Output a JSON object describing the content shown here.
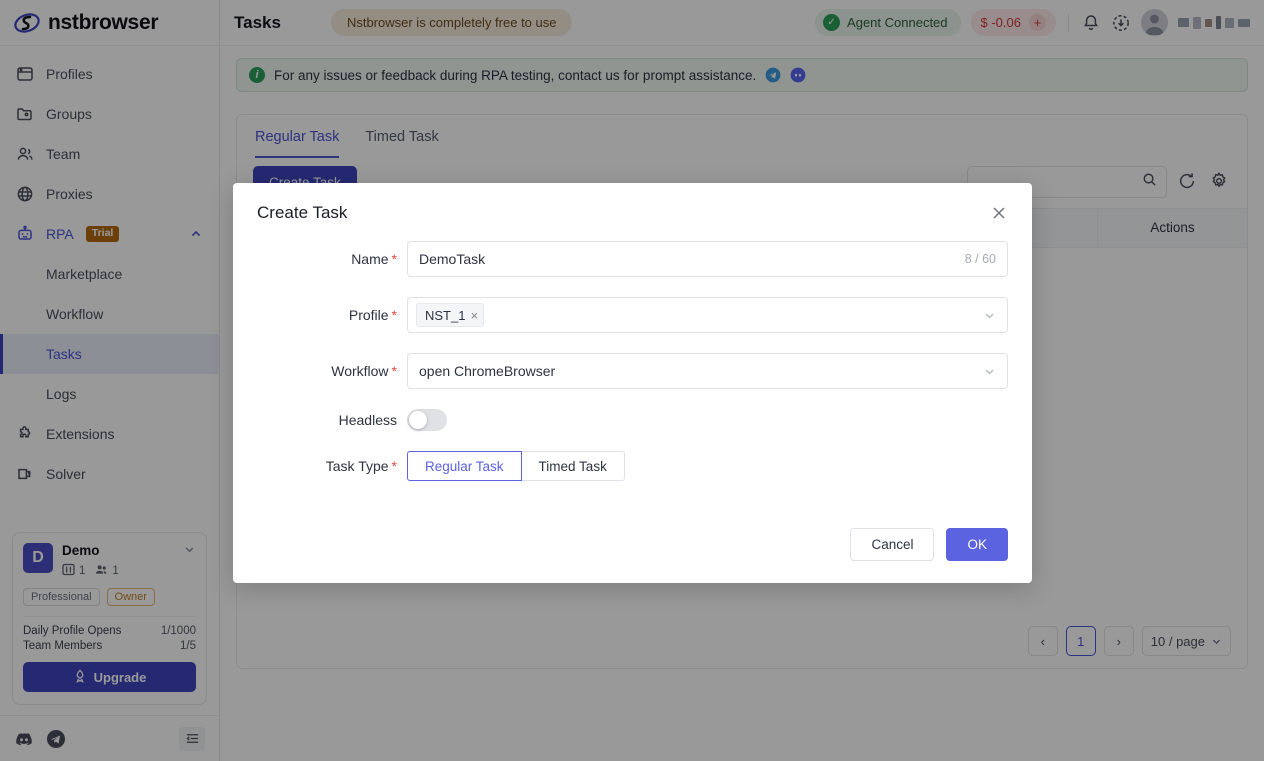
{
  "brand": {
    "name": "nstbrowser"
  },
  "sidebar": {
    "items": [
      {
        "label": "Profiles",
        "icon": "window-icon"
      },
      {
        "label": "Groups",
        "icon": "folder-icon"
      },
      {
        "label": "Team",
        "icon": "people-icon"
      },
      {
        "label": "Proxies",
        "icon": "globe-icon"
      },
      {
        "label": "RPA",
        "icon": "robot-icon",
        "badge": "Trial",
        "expanded": true
      },
      {
        "label": "Marketplace",
        "sub": true
      },
      {
        "label": "Workflow",
        "sub": true
      },
      {
        "label": "Tasks",
        "sub": true,
        "active": true
      },
      {
        "label": "Logs",
        "sub": true
      },
      {
        "label": "Extensions",
        "icon": "puzzle-icon"
      },
      {
        "label": "Solver",
        "icon": "solver-icon"
      }
    ],
    "account": {
      "avatar_letter": "D",
      "name": "Demo",
      "profiles_count": "1",
      "members_count": "1",
      "plan_tag": "Professional",
      "role_tag": "Owner",
      "quotas": [
        {
          "label": "Daily Profile Opens",
          "value": "1/1000"
        },
        {
          "label": "Team Members",
          "value": "1/5"
        }
      ],
      "upgrade_label": "Upgrade"
    },
    "footer": {
      "discord": "discord-icon",
      "telegram": "telegram-icon",
      "collapse": "collapse-sidebar-icon"
    }
  },
  "header": {
    "title": "Tasks",
    "promo": "Nstbrowser is completely free to use",
    "agent_status": "Agent Connected",
    "balance": "$ -0.06",
    "balance_add": "+",
    "notification_icon": "bell-icon",
    "download_icon": "download-icon"
  },
  "notice": {
    "text": "For any issues or feedback during RPA testing, contact us for prompt assistance.",
    "telegram_icon": "telegram-icon",
    "discord_icon": "discord-icon"
  },
  "panel": {
    "tabs": [
      {
        "label": "Regular Task",
        "active": true
      },
      {
        "label": "Timed Task",
        "active": false
      }
    ],
    "create_label": "Create Task",
    "search_placeholder": "",
    "search_value": "",
    "columns": [
      "Actions"
    ],
    "pagination": {
      "prev": "‹",
      "current_page": "1",
      "next": "›",
      "page_size": "10 / page"
    }
  },
  "modal": {
    "title": "Create Task",
    "close_icon": "close-icon",
    "fields": {
      "name": {
        "label": "Name",
        "required": true,
        "value": "DemoTask",
        "placeholder": "",
        "counter": "8 / 60"
      },
      "profile": {
        "label": "Profile",
        "required": true,
        "chips": [
          "NST_1"
        ],
        "chip_remove": "×"
      },
      "workflow": {
        "label": "Workflow",
        "required": true,
        "value": "open ChromeBrowser"
      },
      "headless": {
        "label": "Headless",
        "required": false,
        "on": false
      },
      "task_type": {
        "label": "Task Type",
        "required": true,
        "options": [
          "Regular Task",
          "Timed Task"
        ],
        "selected": "Regular Task"
      }
    },
    "cancel_label": "Cancel",
    "ok_label": "OK"
  },
  "colors": {
    "brand_purple": "#4a56d6",
    "primary_button": "#3f45bf",
    "modal_ok": "#5b63e0",
    "success_green": "#2e9e5b",
    "danger_red": "#d5383a",
    "trial_badge": "#b4690e"
  }
}
